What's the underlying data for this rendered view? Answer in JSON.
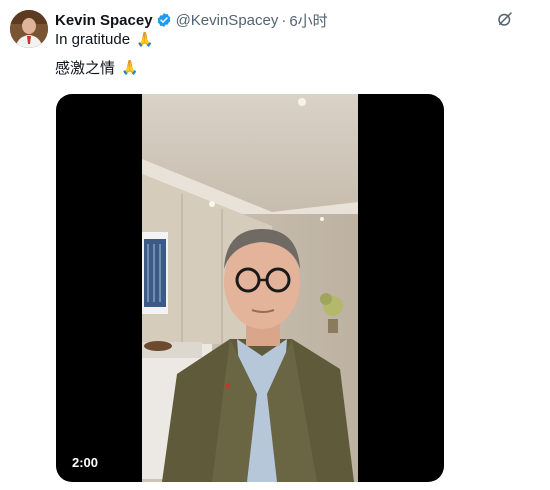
{
  "tweet": {
    "author_name": "Kevin Spacey",
    "handle": "@KevinSpacey",
    "separator": "·",
    "time": "6小时",
    "text_line1": "In gratitude",
    "text_line2": "感激之情",
    "emoji_icon": "folded-hands-icon",
    "verified_color": "#1d9bf0"
  },
  "media": {
    "type": "video",
    "duration": "2:00"
  }
}
